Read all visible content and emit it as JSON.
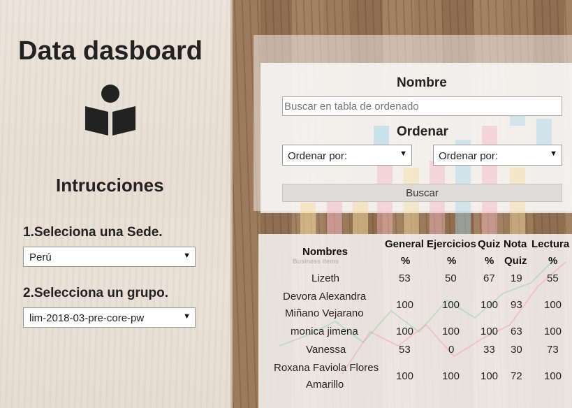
{
  "sidebar": {
    "title": "Data dasboard",
    "icon": "reading-person-icon",
    "instructions_title": "Intrucciones",
    "step1_label": "1.Seleciona una Sede.",
    "step1_value": "Perú",
    "step2_label": "2.Selecciona un grupo.",
    "step2_value": "lim-2018-03-pre-core-pw"
  },
  "filter": {
    "name_label": "Nombre",
    "search_placeholder": "Buscar en tabla de ordenado",
    "order_label": "Ordenar",
    "order_select_1": "Ordenar por:",
    "order_select_2": "Ordenar por:",
    "search_button": "Buscar"
  },
  "table": {
    "headers": {
      "nombres": "Nombres",
      "general_1": "General",
      "general_2": "%",
      "ejercicios_1": "Ejercicios",
      "ejercicios_2": "%",
      "quiz_1": "Quiz",
      "quiz_2": "%",
      "nota_1": "Nota",
      "nota_2": "Quiz",
      "lectura_1": "Lectura",
      "lectura_2": "%"
    },
    "rows": [
      {
        "name_1": "Lizeth",
        "name_2": "",
        "general": "53",
        "ejercicios": "50",
        "quiz": "67",
        "nota": "19",
        "lectura": "55"
      },
      {
        "name_1": "Devora Alexandra",
        "name_2": "Miñano Vejarano",
        "general": "100",
        "ejercicios": "100",
        "quiz": "100",
        "nota": "93",
        "lectura": "100"
      },
      {
        "name_1": "monica jimena",
        "name_2": "",
        "general": "100",
        "ejercicios": "100",
        "quiz": "100",
        "nota": "63",
        "lectura": "100"
      },
      {
        "name_1": "Vanessa",
        "name_2": "",
        "general": "53",
        "ejercicios": "0",
        "quiz": "33",
        "nota": "30",
        "lectura": "73"
      },
      {
        "name_1": "Roxana Faviola Flores",
        "name_2": "Amarillo",
        "general": "100",
        "ejercicios": "100",
        "quiz": "100",
        "nota": "72",
        "lectura": "100"
      }
    ]
  },
  "background": {
    "watermark": "Business items"
  },
  "colors": {
    "title": "#222222",
    "button_bg": "#dedbd8",
    "bar_blue": "#a8d8ea",
    "bar_pink": "#f4b6c2",
    "bar_yellow": "#f6dca0"
  }
}
